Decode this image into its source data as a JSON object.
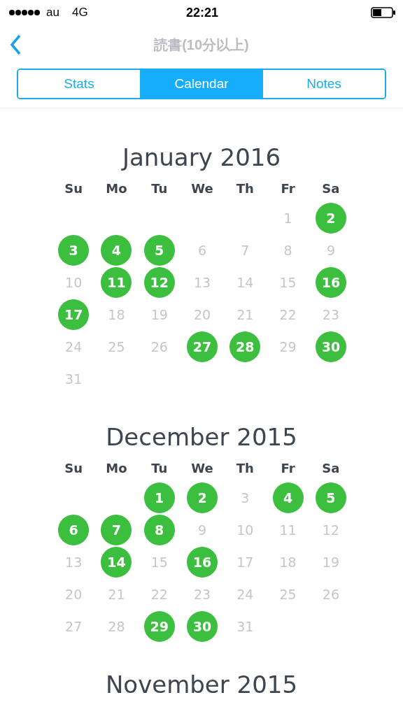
{
  "status_bar": {
    "carrier": "au",
    "network": "4G",
    "time": "22:21"
  },
  "nav": {
    "title": "読書(10分以上)"
  },
  "tabs": [
    {
      "label": "Stats",
      "selected": false
    },
    {
      "label": "Calendar",
      "selected": true
    },
    {
      "label": "Notes",
      "selected": false
    }
  ],
  "months": [
    {
      "title": "January 2016",
      "weekdays": [
        "Su",
        "Mo",
        "Tu",
        "We",
        "Th",
        "Fr",
        "Sa"
      ],
      "weeks": [
        {
          "kind": "first",
          "days": [
            {
              "day": "1",
              "done": false
            },
            {
              "day": "2",
              "done": true
            }
          ]
        },
        {
          "kind": "full",
          "days": [
            {
              "day": "3",
              "done": true
            },
            {
              "day": "4",
              "done": true
            },
            {
              "day": "5",
              "done": true
            },
            {
              "day": "6",
              "done": false
            },
            {
              "day": "7",
              "done": false
            },
            {
              "day": "8",
              "done": false
            },
            {
              "day": "9",
              "done": false
            }
          ]
        },
        {
          "kind": "full",
          "days": [
            {
              "day": "10",
              "done": false
            },
            {
              "day": "11",
              "done": true
            },
            {
              "day": "12",
              "done": true
            },
            {
              "day": "13",
              "done": false
            },
            {
              "day": "14",
              "done": false
            },
            {
              "day": "15",
              "done": false
            },
            {
              "day": "16",
              "done": true
            }
          ]
        },
        {
          "kind": "full",
          "days": [
            {
              "day": "17",
              "done": true
            },
            {
              "day": "18",
              "done": false
            },
            {
              "day": "19",
              "done": false
            },
            {
              "day": "20",
              "done": false
            },
            {
              "day": "21",
              "done": false
            },
            {
              "day": "22",
              "done": false
            },
            {
              "day": "23",
              "done": false
            }
          ]
        },
        {
          "kind": "full",
          "days": [
            {
              "day": "24",
              "done": false
            },
            {
              "day": "25",
              "done": false
            },
            {
              "day": "26",
              "done": false
            },
            {
              "day": "27",
              "done": true
            },
            {
              "day": "28",
              "done": true
            },
            {
              "day": "29",
              "done": false
            },
            {
              "day": "30",
              "done": true
            }
          ]
        },
        {
          "kind": "last",
          "days": [
            {
              "day": "31",
              "done": false
            }
          ]
        }
      ]
    },
    {
      "title": "December 2015",
      "weekdays": [
        "Su",
        "Mo",
        "Tu",
        "We",
        "Th",
        "Fr",
        "Sa"
      ],
      "weeks": [
        {
          "kind": "first",
          "days": [
            {
              "day": "1",
              "done": true
            },
            {
              "day": "2",
              "done": true
            },
            {
              "day": "3",
              "done": false
            },
            {
              "day": "4",
              "done": true
            },
            {
              "day": "5",
              "done": true
            }
          ]
        },
        {
          "kind": "full",
          "days": [
            {
              "day": "6",
              "done": true
            },
            {
              "day": "7",
              "done": true
            },
            {
              "day": "8",
              "done": true
            },
            {
              "day": "9",
              "done": false
            },
            {
              "day": "10",
              "done": false
            },
            {
              "day": "11",
              "done": false
            },
            {
              "day": "12",
              "done": false
            }
          ]
        },
        {
          "kind": "full",
          "days": [
            {
              "day": "13",
              "done": false
            },
            {
              "day": "14",
              "done": true
            },
            {
              "day": "15",
              "done": false
            },
            {
              "day": "16",
              "done": true
            },
            {
              "day": "17",
              "done": false
            },
            {
              "day": "18",
              "done": false
            },
            {
              "day": "19",
              "done": false
            }
          ]
        },
        {
          "kind": "full",
          "days": [
            {
              "day": "20",
              "done": false
            },
            {
              "day": "21",
              "done": false
            },
            {
              "day": "22",
              "done": false
            },
            {
              "day": "23",
              "done": false
            },
            {
              "day": "24",
              "done": false
            },
            {
              "day": "25",
              "done": false
            },
            {
              "day": "26",
              "done": false
            }
          ]
        },
        {
          "kind": "last",
          "days": [
            {
              "day": "27",
              "done": false
            },
            {
              "day": "28",
              "done": false
            },
            {
              "day": "29",
              "done": true
            },
            {
              "day": "30",
              "done": true
            },
            {
              "day": "31",
              "done": false
            }
          ]
        }
      ]
    },
    {
      "title": "November 2015"
    }
  ]
}
